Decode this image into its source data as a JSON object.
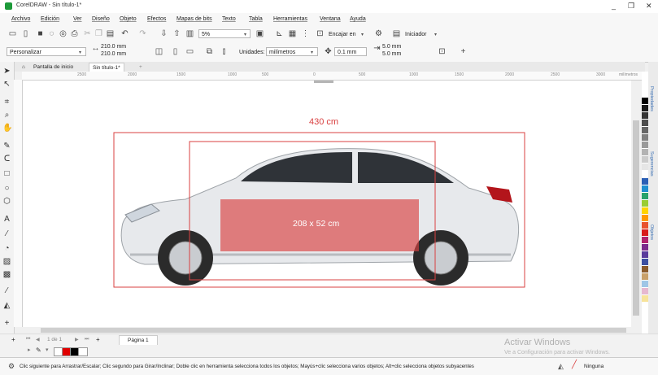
{
  "window": {
    "title": "CorelDRAW - Sin título-1*",
    "minimize": "_",
    "restore": "❐",
    "close": "✕"
  },
  "menu": [
    "Archivo",
    "Edición",
    "Ver",
    "Diseño",
    "Objeto",
    "Efectos",
    "Mapas de bits",
    "Texto",
    "Tabla",
    "Herramientas",
    "Ventana",
    "Ayuda"
  ],
  "toolbar1": {
    "zoom_value": "5%",
    "snap_label": "Encajar en",
    "launcher_label": "Iniciador"
  },
  "toolbar2": {
    "page_preset": "Personalizar",
    "width": "210.0 mm",
    "height": "210.0 mm",
    "units_label": "Unidades:",
    "units_value": "milímetros",
    "nudge": "0.1 mm",
    "dup_x": "5.0 mm",
    "dup_y": "5.0 mm"
  },
  "tabs": {
    "home": "Pantalla de inicio",
    "doc": "Sin título-1*"
  },
  "ruler": {
    "top_ticks": [
      "2500",
      "2000",
      "1500",
      "1000",
      "500",
      "0",
      "500",
      "1000",
      "1500",
      "2000",
      "2500",
      "3000"
    ],
    "units": "milímetros"
  },
  "canvas": {
    "length_label": "430 cm",
    "area_label": "208 x 52 cm"
  },
  "pagebar": {
    "page_info": "1 de 1",
    "page_tab": "Página 1"
  },
  "watermark": {
    "line1": "Activar Windows",
    "line2": "Ve a Configuración para activar Windows."
  },
  "status": {
    "hint": "Clic siguiente para Arrastrar/Escalar; Clic segundo para Girar/Inclinar; Doble clic en herramienta selecciona todos los objetos; Mayús+clic selecciona varios objetos; Alt+clic selecciona objetos subyacentes",
    "fill": "Ninguna"
  },
  "dockers": [
    "Propiedades",
    "Sugerencias",
    "Objetos"
  ],
  "palette_colors": [
    "#000000",
    "#1a1a1a",
    "#333333",
    "#4d4d4d",
    "#666666",
    "#808080",
    "#999999",
    "#b3b3b3",
    "#cccccc",
    "#e6e6e6",
    "#ffffff",
    "#2b5fb5",
    "#1f8fd0",
    "#27a36b",
    "#9acd32",
    "#ffd400",
    "#ff9900",
    "#e8532e",
    "#d81b1b",
    "#b0226e",
    "#7b2a8c",
    "#5a3b9c",
    "#3c4fa0",
    "#8a5a2b",
    "#c8a06a",
    "#9fc6e6",
    "#e6b8d0",
    "#f7e39b"
  ],
  "accent": {
    "measure_red": "#d94040",
    "selection_blue": "#2a62c9"
  }
}
